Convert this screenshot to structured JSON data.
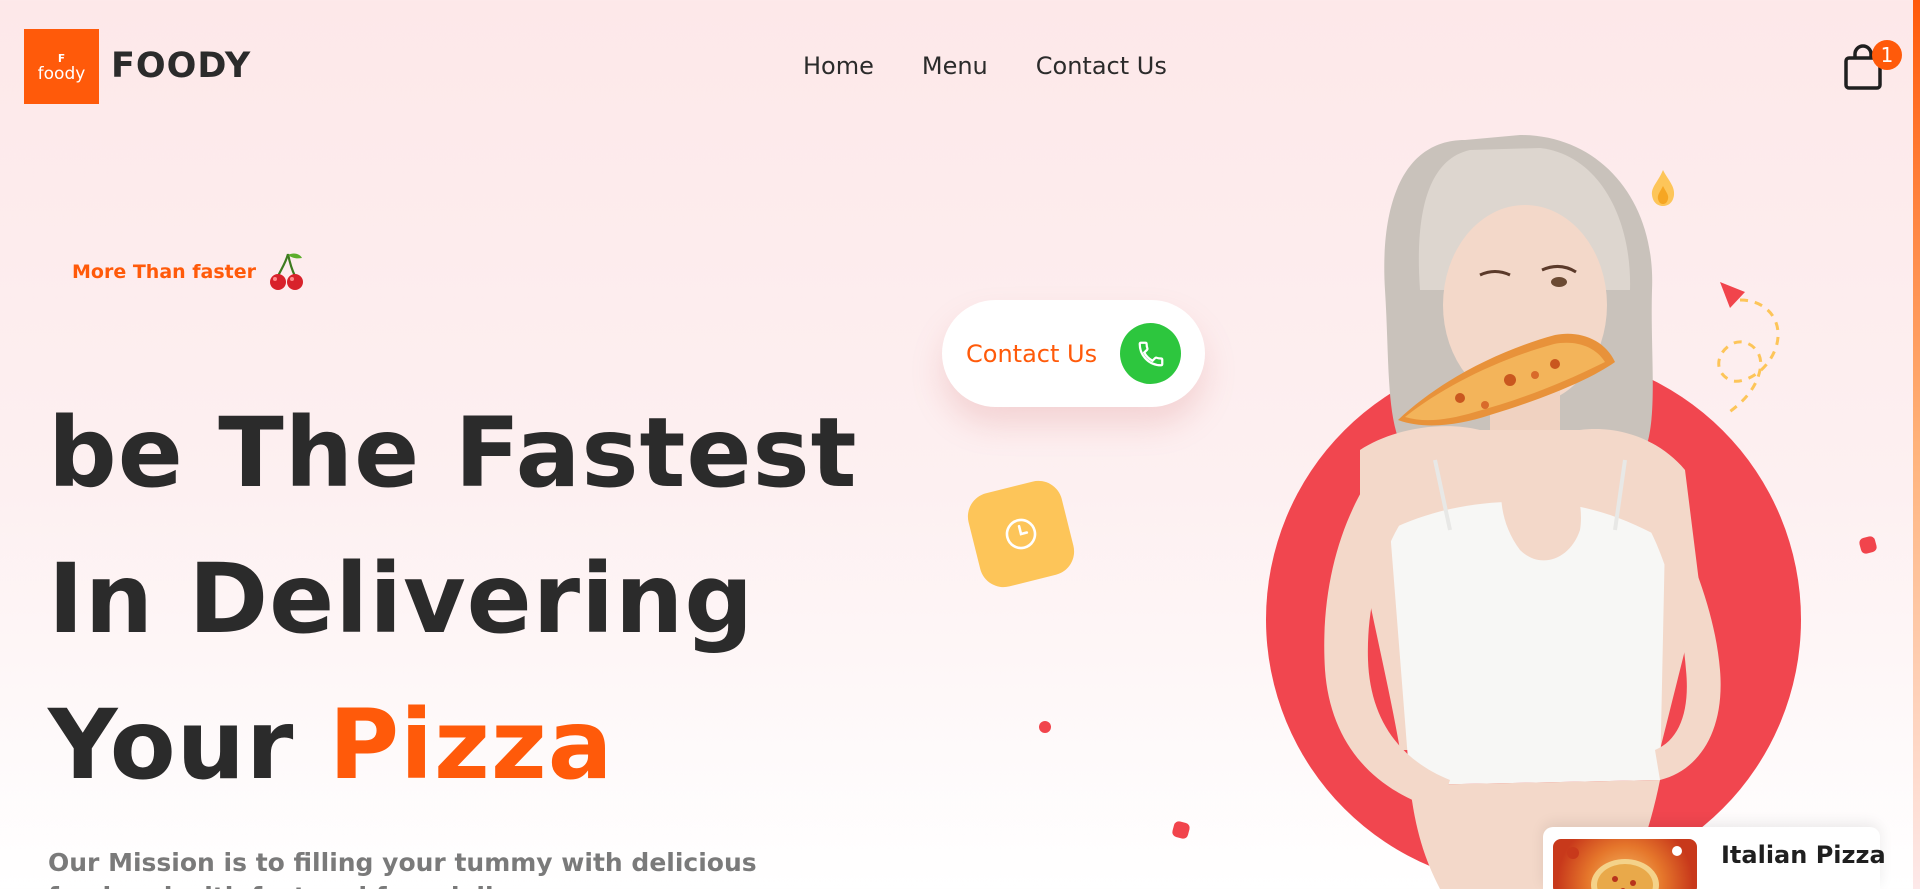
{
  "brand": {
    "logo_mark": "ꜰ",
    "logo_word": "foody",
    "name": "FOODY"
  },
  "nav": {
    "items": [
      "Home",
      "Menu",
      "Contact Us"
    ]
  },
  "cart": {
    "count": "1"
  },
  "hero": {
    "tagline": "More Than faster",
    "title_line1": "be The Fastest",
    "title_line2": "In Delivering",
    "title_line3_prefix": "Your",
    "title_line3_accent": "Pizza",
    "mission": "Our Mission is to filling your tummy with delicious food and with fast and free delivery"
  },
  "contact_pill": {
    "label": "Contact Us"
  },
  "product_card": {
    "name": "Italian Pizza"
  },
  "colors": {
    "accent": "#ff5a0a",
    "red_circle": "#f1464f",
    "phone_green": "#2dc63e",
    "clock_yellow": "#fdc559"
  },
  "icons": {
    "cart": "shopping-bag-icon",
    "phone": "phone-icon",
    "clock": "clock-icon",
    "cherry": "cherry-icon",
    "flame": "flame-icon"
  }
}
